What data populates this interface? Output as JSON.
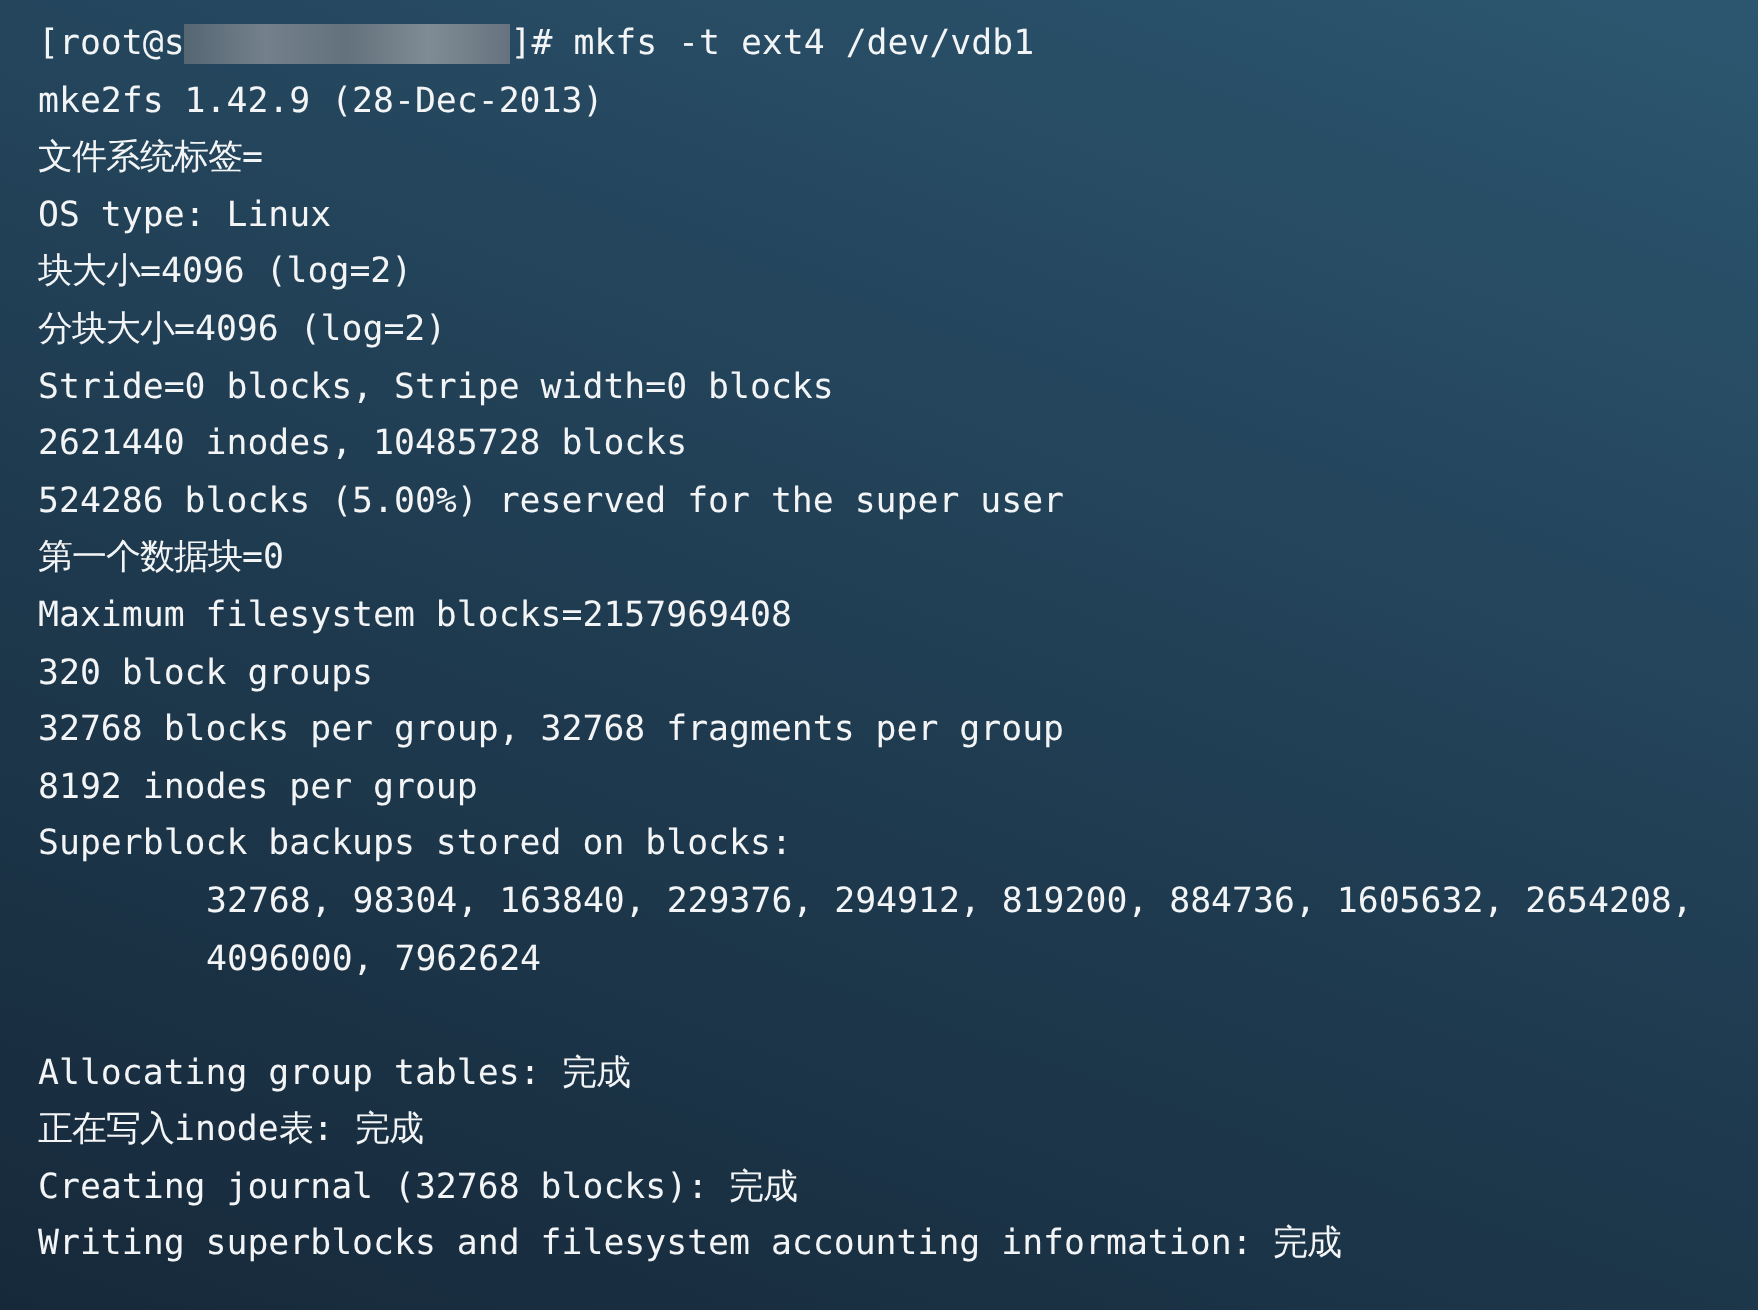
{
  "terminal": {
    "prompt": {
      "before": "[root@s",
      "after": "]# mkfs -t ext4 /dev/vdb1",
      "redacted": true
    },
    "lines": [
      {
        "kind": "plain",
        "text": "mke2fs 1.42.9 (28-Dec-2013)"
      },
      {
        "kind": "plain",
        "text": "文件系统标签="
      },
      {
        "kind": "plain",
        "text": "OS type: Linux"
      },
      {
        "kind": "plain",
        "text": "块大小=4096 (log=2)"
      },
      {
        "kind": "plain",
        "text": "分块大小=4096 (log=2)"
      },
      {
        "kind": "plain",
        "text": "Stride=0 blocks, Stripe width=0 blocks"
      },
      {
        "kind": "plain",
        "text": "2621440 inodes, 10485728 blocks"
      },
      {
        "kind": "plain",
        "text": "524286 blocks (5.00%) reserved for the super user"
      },
      {
        "kind": "plain",
        "text": "第一个数据块=0"
      },
      {
        "kind": "plain",
        "text": "Maximum filesystem blocks=2157969408"
      },
      {
        "kind": "plain",
        "text": "320 block groups"
      },
      {
        "kind": "plain",
        "text": "32768 blocks per group, 32768 fragments per group"
      },
      {
        "kind": "plain",
        "text": "8192 inodes per group"
      },
      {
        "kind": "plain",
        "text": "Superblock backups stored on blocks:"
      },
      {
        "kind": "indented",
        "text": "32768, 98304, 163840, 229376, 294912, 819200, 884736, 1605632, 2654208,"
      },
      {
        "kind": "indented",
        "text": "4096000, 7962624"
      },
      {
        "kind": "blank"
      },
      {
        "kind": "plain",
        "text": "Allocating group tables: 完成"
      },
      {
        "kind": "plain",
        "text": "正在写入inode表: 完成"
      },
      {
        "kind": "plain",
        "text": "Creating journal (32768 blocks): 完成"
      },
      {
        "kind": "plain",
        "text": "Writing superblocks and filesystem accounting information: 完成"
      }
    ]
  }
}
